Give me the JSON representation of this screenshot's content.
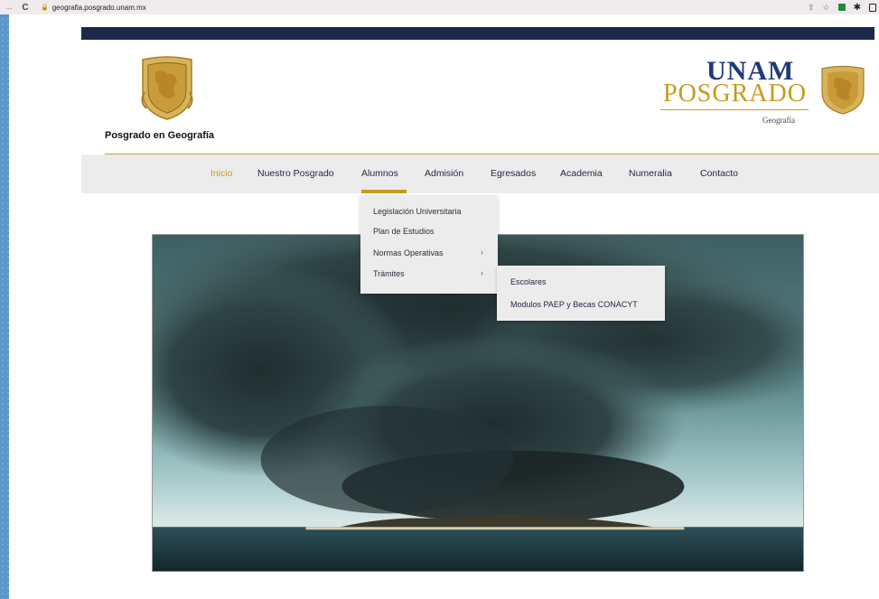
{
  "browser": {
    "url": "geografia.posgrado.unam.mx",
    "icons": [
      "back-arrow-icon",
      "reload-icon",
      "lock-icon",
      "share-icon",
      "star-icon",
      "extension-icon",
      "puzzle-icon",
      "sidebar-icon"
    ]
  },
  "header": {
    "site_name": "Posgrado en Geografía",
    "logo": {
      "line1": "UNAM",
      "line2": "POSGRADO",
      "sub": "Geografía"
    }
  },
  "nav": {
    "items": [
      {
        "label": "Inicio",
        "active": true
      },
      {
        "label": "Nuestro Posgrado"
      },
      {
        "label": "Alumnos",
        "expanded": true
      },
      {
        "label": "Admisión"
      },
      {
        "label": "Egresados"
      },
      {
        "label": "Academia"
      },
      {
        "label": "Numeralia"
      },
      {
        "label": "Contacto"
      }
    ]
  },
  "dropdown": {
    "items": [
      {
        "label": "Legislación Universitaria"
      },
      {
        "label": "Plan de Estudios"
      },
      {
        "label": "Normas Operativas",
        "caret": "›"
      },
      {
        "label": "Trámites",
        "caret": "›"
      }
    ]
  },
  "submenu": {
    "items": [
      {
        "label": "Escolares"
      },
      {
        "label": "Modulos PAEP y Becas CONACYT"
      }
    ]
  },
  "colors": {
    "accent_gold": "#c79a20",
    "navy": "#1b2a4a",
    "nav_bg": "#ececec",
    "desktop_blue": "#5b97cc"
  }
}
